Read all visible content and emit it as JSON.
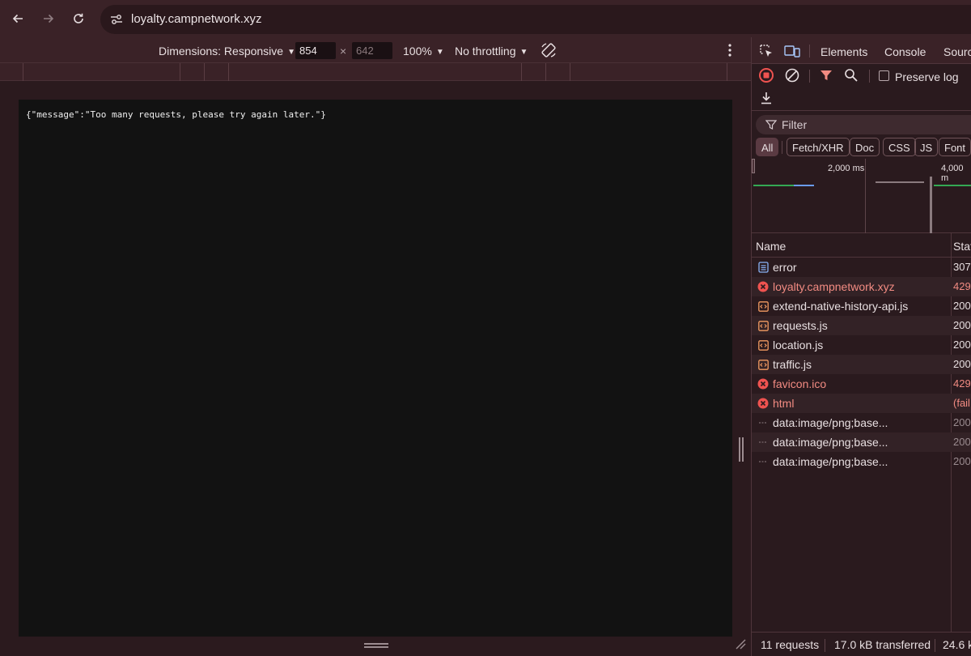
{
  "browser": {
    "url": "loyalty.campnetwork.xyz"
  },
  "device_toolbar": {
    "dimensions_label": "Dimensions: Responsive",
    "width_value": "854",
    "times": "×",
    "height_value": "642",
    "zoom": "100%",
    "throttling": "No throttling"
  },
  "page": {
    "message": "{\"message\":\"Too many requests, please try again later.\"}"
  },
  "devtools": {
    "tabs": [
      "Elements",
      "Console",
      "Sourc"
    ],
    "preserve_log_label": "Preserve log",
    "filter_placeholder": "Filter",
    "type_filters": [
      "All",
      "Fetch/XHR",
      "Doc",
      "CSS",
      "JS",
      "Font"
    ],
    "overview_labels": [
      "2,000 ms",
      "4,000 m"
    ],
    "columns": {
      "name": "Name",
      "status": "Stat"
    },
    "requests": [
      {
        "name": "error",
        "status": "307",
        "icon": "document-icon",
        "kind": "normal"
      },
      {
        "name": "loyalty.campnetwork.xyz",
        "status": "429",
        "icon": "error-icon",
        "kind": "err"
      },
      {
        "name": "extend-native-history-api.js",
        "status": "200",
        "icon": "script-icon",
        "kind": "normal"
      },
      {
        "name": "requests.js",
        "status": "200",
        "icon": "script-icon",
        "kind": "normal"
      },
      {
        "name": "location.js",
        "status": "200",
        "icon": "script-icon",
        "kind": "normal"
      },
      {
        "name": "traffic.js",
        "status": "200",
        "icon": "script-icon",
        "kind": "normal"
      },
      {
        "name": "favicon.ico",
        "status": "429",
        "icon": "error-icon",
        "kind": "err"
      },
      {
        "name": "html",
        "status": "(fail",
        "icon": "error-icon",
        "kind": "err-name"
      },
      {
        "name": "data:image/png;base...",
        "status": "200",
        "icon": "image-icon",
        "kind": "dim"
      },
      {
        "name": "data:image/png;base...",
        "status": "200",
        "icon": "image-icon",
        "kind": "dim"
      },
      {
        "name": "data:image/png;base...",
        "status": "200",
        "icon": "image-icon",
        "kind": "dim"
      }
    ],
    "summary": {
      "requests": "11 requests",
      "transferred": "17.0 kB transferred",
      "resources": "24.6 k"
    },
    "colors": {
      "error": "#f28b82",
      "record": "#ef5350",
      "filter_active": "#f28b82"
    }
  }
}
